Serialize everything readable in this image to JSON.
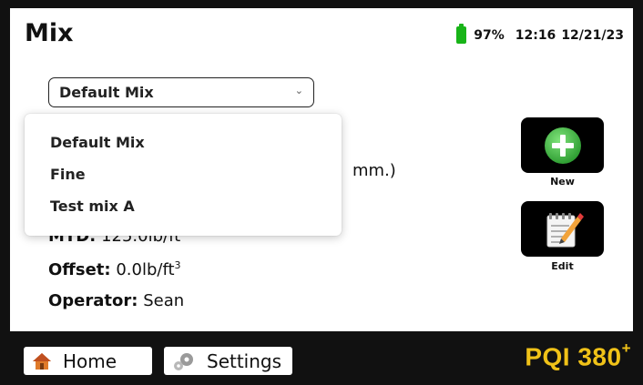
{
  "header": {
    "title": "Mix",
    "battery_percent": "97%",
    "time": "12:16",
    "date": "12/21/23",
    "battery_color": "#18b418"
  },
  "mix_select": {
    "value": "Default Mix",
    "icon": "chevron-down-icon"
  },
  "dropdown": {
    "options": [
      "Default Mix",
      "Fine",
      "Test mix A"
    ]
  },
  "details": {
    "partial_text": "mm.)",
    "mtd_label": "MTD:",
    "mtd_value": "125.0lb/ft",
    "offset_label": "Offset:",
    "offset_value": "0.0lb/ft",
    "offset_exp": "3",
    "operator_label": "Operator:",
    "operator_value": "Sean"
  },
  "actions": {
    "new_label": "New",
    "new_icon": "plus-circle-icon",
    "edit_label": "Edit",
    "edit_icon": "edit-notepad-icon"
  },
  "footer": {
    "home_label": "Home",
    "home_icon": "house-icon",
    "settings_label": "Settings",
    "settings_icon": "gears-icon",
    "brand": "PQI 380",
    "brand_sup": "+",
    "brand_color": "#f0c218"
  }
}
